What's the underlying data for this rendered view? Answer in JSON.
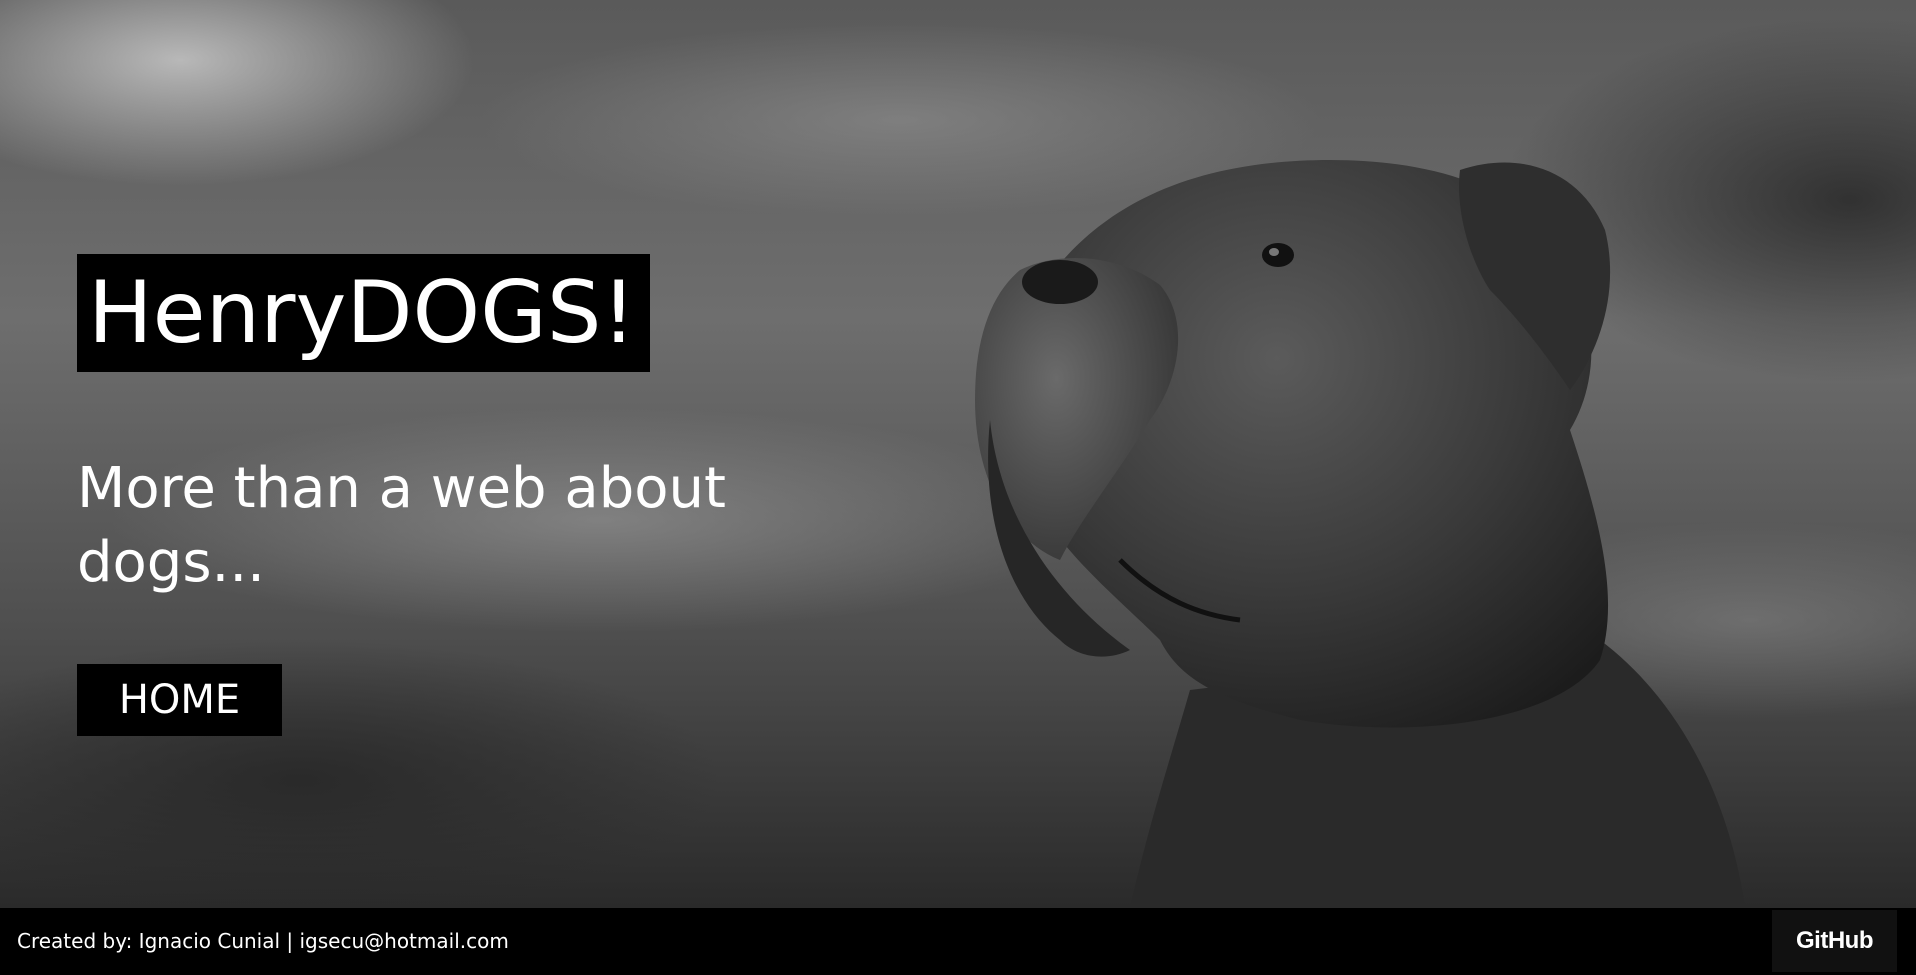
{
  "hero": {
    "title": "HenryDOGS!",
    "subtitle": "More than a web about dogs...",
    "home_label": "HOME",
    "background_image": "dog-portrait-photo"
  },
  "footer": {
    "credit": "Created by: Ignacio Cunial | igsecu@hotmail.com",
    "github_label": "GitHub"
  },
  "colors": {
    "title_bg": "#000000",
    "text": "#ffffff",
    "footer_bg": "#000000"
  }
}
